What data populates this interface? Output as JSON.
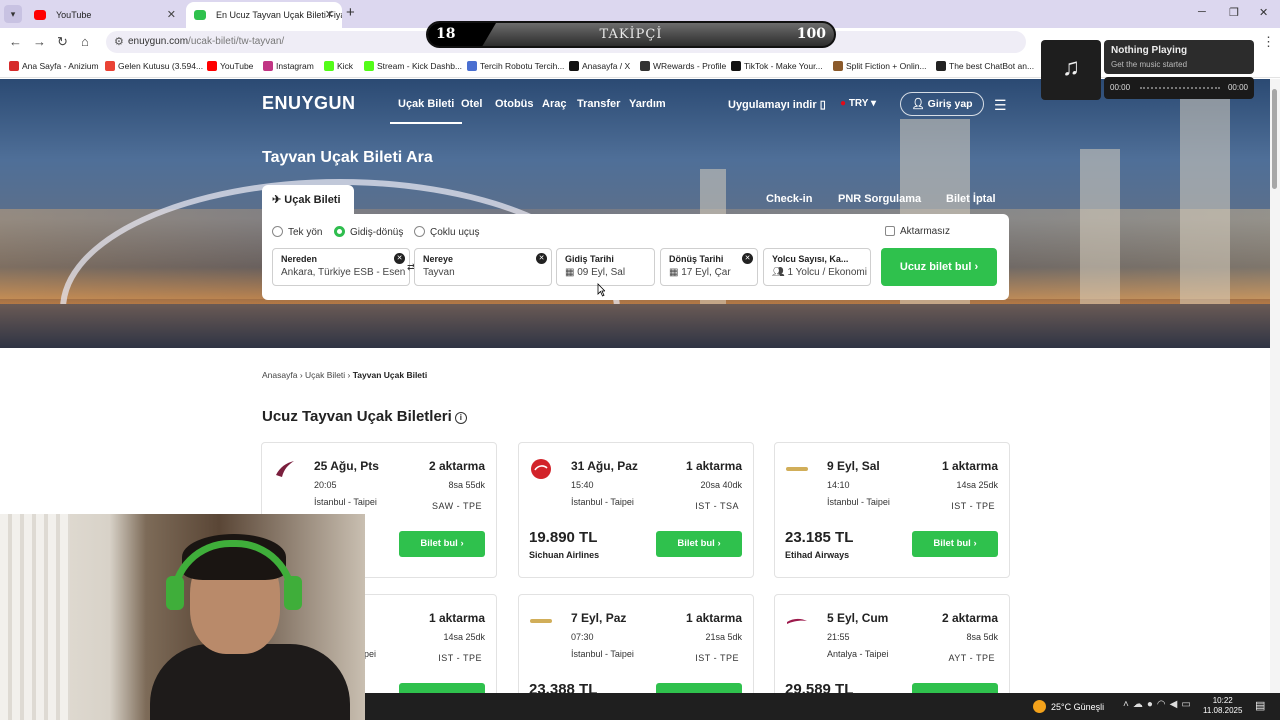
{
  "browser": {
    "tabs": [
      {
        "title": "YouTube",
        "favicon_color": "#ff0000"
      },
      {
        "title": "En Ucuz Tayvan Uçak Bileti Fiyatl",
        "favicon_color": "#2fc14d"
      }
    ],
    "url_host": "enuygun.com",
    "url_path": "/ucak-bileti/tw-tayvan/",
    "bookmarks": [
      {
        "label": "Ana Sayfa - Anizium",
        "color": "#d62b2b"
      },
      {
        "label": "Gelen Kutusu (3.594...",
        "color": "#ea4335"
      },
      {
        "label": "YouTube",
        "color": "#ff0000"
      },
      {
        "label": "Instagram",
        "color": "#c13584"
      },
      {
        "label": "Kick",
        "color": "#53fc18"
      },
      {
        "label": "Stream - Kick Dashb...",
        "color": "#53fc18"
      },
      {
        "label": "Tercih Robotu Tercih...",
        "color": "#4a6fd1"
      },
      {
        "label": "Anasayfa / X",
        "color": "#111111"
      },
      {
        "label": "WRewards - Profile",
        "color": "#333333"
      },
      {
        "label": "TikTok - Make Your...",
        "color": "#111111"
      },
      {
        "label": "Split Fiction + Onlin...",
        "color": "#8b5a2b"
      },
      {
        "label": "The best ChatBot an...",
        "color": "#222222"
      }
    ]
  },
  "overlay": {
    "followers": {
      "current": "18",
      "label": "TAKİPÇİ",
      "goal": "100"
    },
    "music": {
      "title": "Nothing Playing",
      "subtitle": "Get the music started",
      "time_left": "00:00",
      "time_right": "00:00"
    }
  },
  "site": {
    "logo": "ENUYGUN",
    "nav": [
      "Uçak Bileti",
      "Otel",
      "Otobüs",
      "Araç",
      "Transfer",
      "Yardım"
    ],
    "app_download": "Uygulamayı indir",
    "currency": "TRY",
    "login": "Giriş yap",
    "hero_title": "Tayvan Uçak Bileti Ara",
    "flight_tab": "Uçak Bileti",
    "hero_links": [
      "Check-in",
      "PNR Sorgulama",
      "Bilet İptal"
    ],
    "trip_types": [
      "Tek yön",
      "Gidiş-dönüş",
      "Çoklu uçuş"
    ],
    "selected_trip_type": "Gidiş-dönüş",
    "nonstop_label": "Aktarmasız",
    "fields": {
      "from": {
        "label": "Nereden",
        "value": "Ankara, Türkiye ESB - Esen"
      },
      "to": {
        "label": "Nereye",
        "value": "Tayvan"
      },
      "depart": {
        "label": "Gidiş Tarihi",
        "value": "09 Eyl, Sal"
      },
      "return": {
        "label": "Dönüş Tarihi",
        "value": "17 Eyl, Çar"
      },
      "passengers": {
        "label": "Yolcu Sayısı, Ka...",
        "value": "1 Yolcu / Ekonomi"
      }
    },
    "search_button": "Ucuz bilet bul"
  },
  "breadcrumb": [
    "Anasayfa",
    "Uçak Bileti",
    "Tayvan Uçak Bileti"
  ],
  "section_title": "Ucuz Tayvan Uçak Biletleri",
  "cards": [
    {
      "date": "25 Ağu, Pts",
      "stops": "2 aktarma",
      "time": "20:05",
      "duration": "8sa 55dk",
      "route": "İstanbul - Taipei",
      "from": "SAW",
      "to": "TPE",
      "price": "",
      "airline": "",
      "button": "Bilet bul",
      "logo_color": "#7a1f3d"
    },
    {
      "date": "31 Ağu, Paz",
      "stops": "1 aktarma",
      "time": "15:40",
      "duration": "20sa 40dk",
      "route": "İstanbul - Taipei",
      "from": "IST",
      "to": "TSA",
      "price": "19.890 TL",
      "airline": "Sichuan Airlines",
      "button": "Bilet bul",
      "logo_color": "#d2232a"
    },
    {
      "date": "9 Eyl, Sal",
      "stops": "1 aktarma",
      "time": "14:10",
      "duration": "14sa 25dk",
      "route": "İstanbul - Taipei",
      "from": "IST",
      "to": "TPE",
      "price": "23.185 TL",
      "airline": "Etihad Airways",
      "button": "Bilet bul",
      "logo_color": "#bd8b13"
    },
    {
      "date": "",
      "stops": "1 aktarma",
      "time": "",
      "duration": "14sa 25dk",
      "route": "ipei",
      "from": "IST",
      "to": "TPE",
      "price": "",
      "airline": "",
      "button": "",
      "logo_color": "#bd8b13"
    },
    {
      "date": "7 Eyl, Paz",
      "stops": "1 aktarma",
      "time": "07:30",
      "duration": "21sa 5dk",
      "route": "İstanbul - Taipei",
      "from": "IST",
      "to": "TPE",
      "price": "23.388 TL",
      "airline": "",
      "button": "",
      "logo_color": "#bd8b13"
    },
    {
      "date": "5 Eyl, Cum",
      "stops": "2 aktarma",
      "time": "21:55",
      "duration": "8sa 5dk",
      "route": "Antalya - Taipei",
      "from": "AYT",
      "to": "TPE",
      "price": "29.589 TL",
      "airline": "",
      "button": "",
      "logo_color": "#9c1a4c"
    }
  ],
  "taskbar": {
    "temp": "25°C",
    "weather": "Güneşli",
    "time": "10:22",
    "date": "11.08.2025"
  }
}
